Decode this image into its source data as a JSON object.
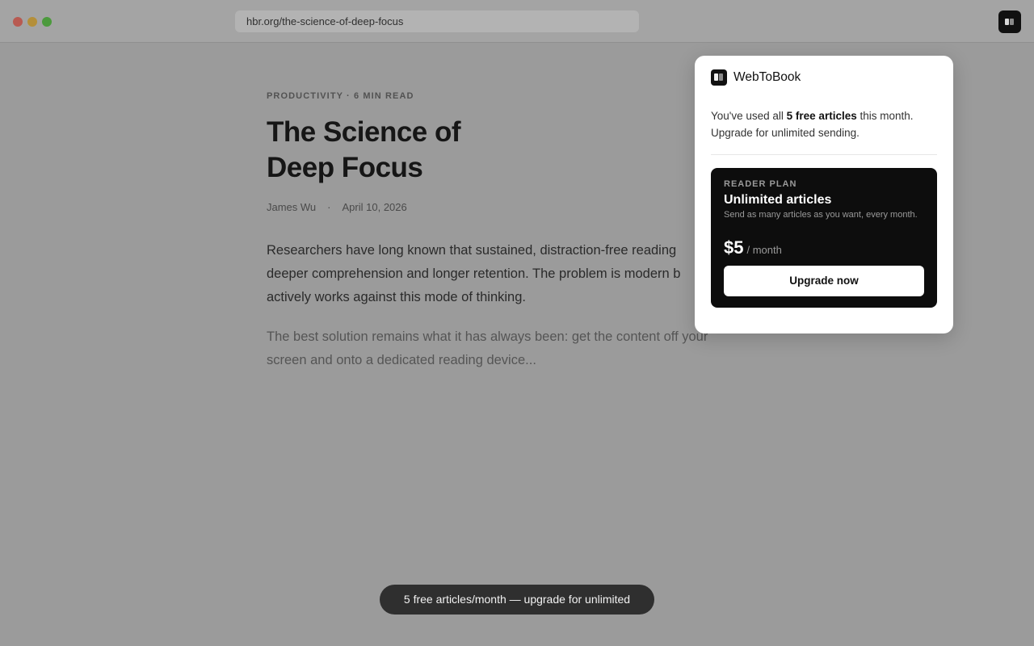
{
  "browser": {
    "url": "hbr.org/the-science-of-deep-focus",
    "window_controls": [
      "close",
      "minimize",
      "zoom"
    ],
    "extension_icon": "book-icon"
  },
  "article": {
    "kicker": "PRODUCTIVITY · 6 MIN READ",
    "title": "The Science of Deep Focus",
    "author": "James Wu",
    "separator": "·",
    "date": "April 10, 2026",
    "paragraph1": "Researchers have long known that sustained, distraction-free reading deeper comprehension and longer retention. The problem is modern b actively works against this mode of thinking.",
    "paragraph1_lines": [
      "Researchers have long known that sustained, distraction-free reading",
      "deeper comprehension and longer retention. The problem is modern b",
      "actively works against this mode of thinking."
    ],
    "paragraph2_lines": [
      "The best solution remains what it has always been: get the content off your",
      "screen and onto a dedicated reading device..."
    ]
  },
  "popup": {
    "app_name": "WebToBook",
    "message_prefix": "You've used all ",
    "message_bold": "5 free articles",
    "message_suffix": " this month.",
    "message_line2": "Upgrade for unlimited sending.",
    "plan": {
      "label": "READER PLAN",
      "title": "Unlimited articles",
      "description": "Send as many articles as you want, every month.",
      "price": "$5",
      "period": "/ month",
      "cta": "Upgrade now"
    }
  },
  "toast": {
    "text": "5 free articles/month — upgrade for unlimited"
  },
  "colors": {
    "overlay_dim": "#9b9b9b",
    "plan_bg": "#0d0d0d",
    "toast_bg": "#2f2f2f"
  }
}
